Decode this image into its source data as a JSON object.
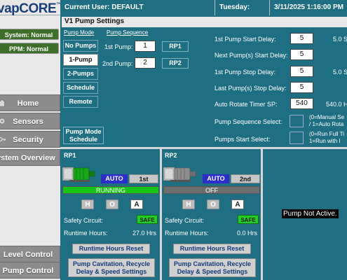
{
  "header": {
    "logo_text": "vapCORE",
    "logo_mark": "™",
    "current_user": "Current User: DEFAULT",
    "day": "Tuesday:",
    "datetime": "3/11/2025 1:16:00 PM"
  },
  "sidebar": {
    "system_status": "System: Normal",
    "ppm_status": "PPM: Normal",
    "nav": [
      {
        "label": "Home",
        "icon": "home-icon"
      },
      {
        "label": "Sensors",
        "icon": "gear-icon"
      },
      {
        "label": "Security",
        "icon": "key-icon"
      },
      {
        "label": "ystem Overview",
        "icon": ""
      },
      {
        "label": "Level Control",
        "icon": ""
      },
      {
        "label": "Pump Control",
        "icon": ""
      }
    ]
  },
  "main": {
    "title": "V1 Pump Settings",
    "pump_mode_label": "Pump Mode",
    "pump_sequence_label": "Pump Sequence",
    "modes": [
      "No Pumps",
      "1-Pump",
      "2-Pumps",
      "Schedule",
      "Remote"
    ],
    "active_mode": "1-Pump",
    "first_pump_label": "1st Pump:",
    "first_pump_value": "1",
    "first_pump_button": "RP1",
    "second_pump_label": "2nd Pump:",
    "second_pump_value": "2",
    "second_pump_button": "RP2",
    "pump_mode_schedule_line1": "Pump Mode",
    "pump_mode_schedule_line2": "Schedule",
    "settings": [
      {
        "label": "1st Pump Start Delay:",
        "value": "5",
        "suffix": "5.0 S"
      },
      {
        "label": "Next Pump(s) Start Delay:",
        "value": "5",
        "suffix": ""
      },
      {
        "label": "1st Pump Stop Delay:",
        "value": "5",
        "suffix": "5.0 S"
      },
      {
        "label": "Last Pump(s) Stop Delay:",
        "value": "5",
        "suffix": ""
      },
      {
        "label": "Auto Rotate Timer SP:",
        "value": "540",
        "suffix": "540.0 H"
      }
    ],
    "sequence_select_label": "Pump Sequence Select:",
    "sequence_select_note1": "(0=Manual Se",
    "sequence_select_note2": "/ 1=Auto Rota",
    "start_select_label": "Pumps Start Select:",
    "start_select_note1": "(0=Run Full Ti",
    "start_select_note2": " 1=Run with l"
  },
  "pumps": [
    {
      "name": "RP1",
      "mode": "AUTO",
      "sequence": "1st",
      "status": "RUNNING",
      "status_color": "#18c418",
      "hoa": [
        "H",
        "O",
        "A"
      ],
      "hoa_selected": "A",
      "safety_label": "Safety Circuit:",
      "safety_value": "SAFE",
      "runtime_label": "Runtime Hours:",
      "runtime_value": "27.0 Hrs",
      "reset_label": "Runtime Hours Reset",
      "cav_line1": "Pump Cavitation, Recycle",
      "cav_line2": "Delay & Speed Settings"
    },
    {
      "name": "RP2",
      "mode": "AUTO",
      "sequence": "2nd",
      "status": "OFF",
      "status_color": "#6e6e6e",
      "hoa": [
        "H",
        "O",
        "A"
      ],
      "hoa_selected": "A",
      "safety_label": "Safety Circuit:",
      "safety_value": "SAFE",
      "runtime_label": "Runtime Hours:",
      "runtime_value": "0.0 Hrs",
      "reset_label": "Runtime Hours Reset",
      "cav_line1": "Pump Cavitation, Recycle",
      "cav_line2": "Delay & Speed Settings"
    }
  ],
  "pump3_status": "Pump Not Active."
}
